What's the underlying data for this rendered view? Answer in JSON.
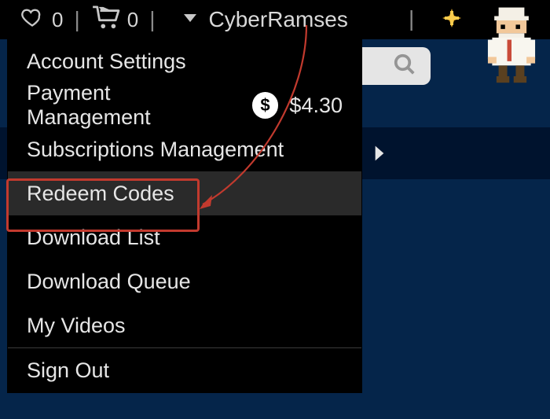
{
  "topbar": {
    "wishlist_count": "0",
    "cart_count": "0",
    "username": "CyberRamses"
  },
  "menu": {
    "account_settings": "Account Settings",
    "payment_management": "Payment Management",
    "balance": "$4.30",
    "subscriptions": "Subscriptions Management",
    "redeem_codes": "Redeem Codes",
    "download_list": "Download List",
    "download_queue": "Download Queue",
    "my_videos": "My Videos",
    "sign_out": "Sign Out"
  },
  "icons": {
    "dollar_glyph": "$"
  }
}
